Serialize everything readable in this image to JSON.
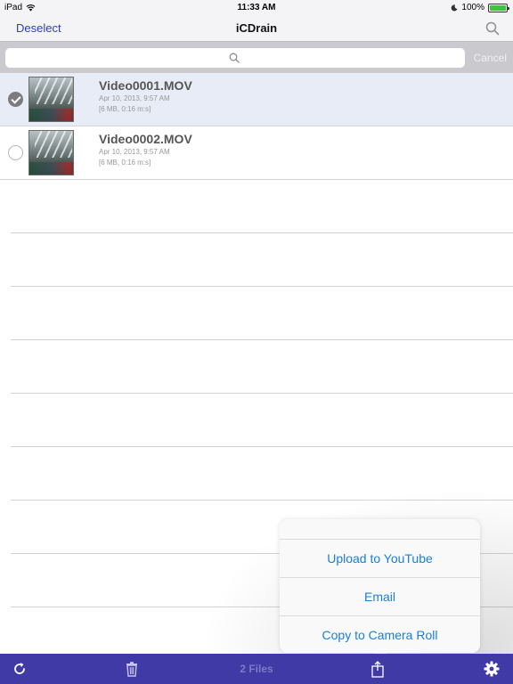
{
  "status_bar": {
    "device": "iPad",
    "time": "11:33 AM",
    "battery": "100%",
    "battery_level": 1.0
  },
  "nav": {
    "left_button": "Deselect",
    "title": "iCDrain"
  },
  "search": {
    "placeholder": "",
    "cancel_label": "Cancel"
  },
  "files": [
    {
      "name": "Video0001.MOV",
      "date": "Apr 10, 2013, 9:57 AM",
      "info": "[6 MB, 0:16 m:s]",
      "selected": true
    },
    {
      "name": "Video0002.MOV",
      "date": "Apr 10, 2013, 9:57 AM",
      "info": "[6 MB, 0:16 m:s]",
      "selected": false
    }
  ],
  "share_menu": {
    "items": [
      "Upload to YouTube",
      "Email",
      "Copy to Camera Roll"
    ]
  },
  "toolbar": {
    "files_count": "2 Files",
    "icons": [
      "refresh-icon",
      "trash-icon",
      "share-icon",
      "gear-icon"
    ]
  },
  "colors": {
    "accent": "#2b3cd0",
    "toolbar": "#3f3aa6",
    "menu_text": "#1a7fd6",
    "battery": "#3cc43c"
  }
}
